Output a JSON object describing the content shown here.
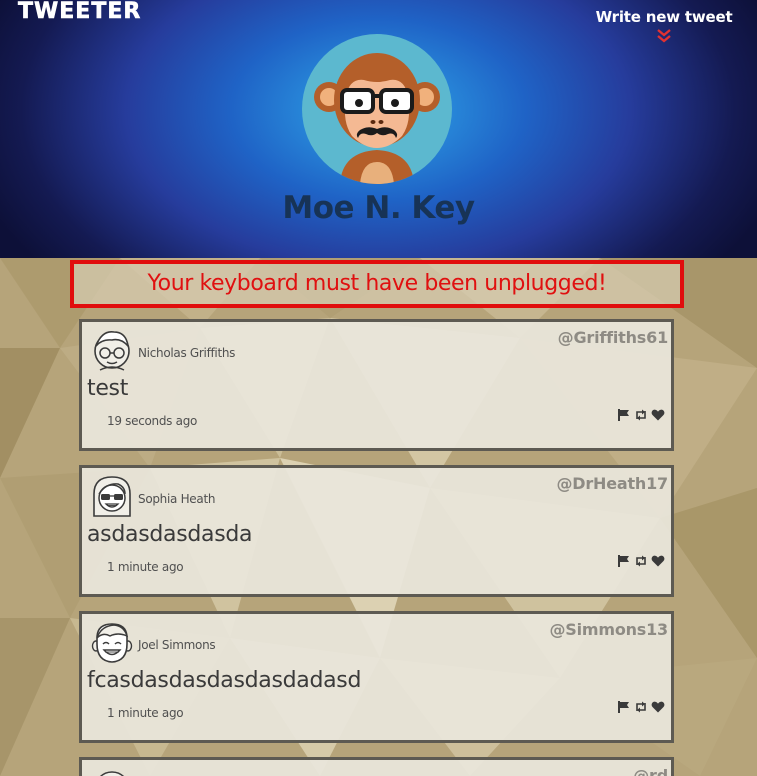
{
  "app": {
    "logo": "TWEETER",
    "write_tweet_label": "Write new tweet"
  },
  "profile": {
    "name": "Moe N. Key"
  },
  "error": {
    "message": "Your keyboard must have been unplugged!"
  },
  "tweets": [
    {
      "author": "Nicholas Griffiths",
      "handle": "@Griffiths61",
      "text": "test",
      "time": "19 seconds ago"
    },
    {
      "author": "Sophia Heath",
      "handle": "@DrHeath17",
      "text": "asdasdasdasda",
      "time": "1 minute ago"
    },
    {
      "author": "Joel Simmons",
      "handle": "@Simmons13",
      "text": "fcasdasdasdasdasdadasd",
      "time": "1 minute ago"
    },
    {
      "handle": "@rd"
    }
  ],
  "icons": {
    "flag": "flag-icon",
    "retweet": "retweet-icon",
    "like": "heart-icon"
  },
  "colors": {
    "header_glow": "#2fa8ea",
    "header_edge": "#0d1038",
    "error_red": "#e01010",
    "background_tan": "#b8a67a",
    "card_border": "#5d5a52",
    "name_navy": "#173356"
  }
}
